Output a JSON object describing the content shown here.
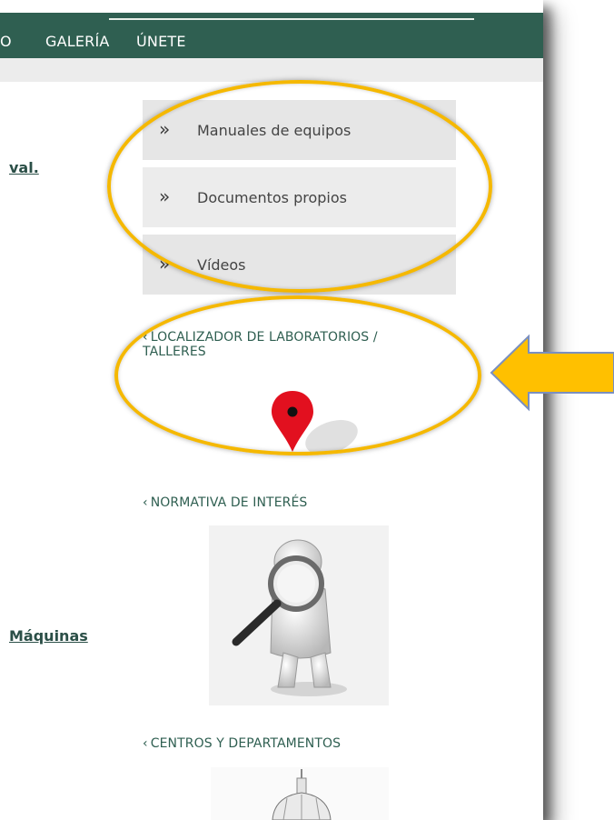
{
  "nav": {
    "items": [
      "O",
      "GALERÍA",
      "ÚNETE"
    ]
  },
  "left_links": {
    "link1": "val.",
    "link2": "Máquinas"
  },
  "sidebar_menu": [
    {
      "label": "Manuales de equipos",
      "icon": "double-chevron-right-icon"
    },
    {
      "label": "Documentos propios",
      "icon": "double-chevron-right-icon"
    },
    {
      "label": "Vídeos",
      "icon": "double-chevron-right-icon"
    }
  ],
  "sections": {
    "localizador": {
      "line1": "LOCALIZADOR DE LABORATORIOS /",
      "line2": "TALLERES",
      "icon": "map-pin-icon"
    },
    "normativa": {
      "title": "NORMATIVA DE INTERÉS",
      "image": "magnifying-glass-figure-image"
    },
    "centros": {
      "title": "CENTROS Y DEPARTAMENTOS",
      "image": "dome-building-image"
    }
  },
  "glyphs": {
    "chevron": "»",
    "back": "‹"
  },
  "colors": {
    "nav_bg": "#2f5f51",
    "highlight": "#f5b800",
    "arrow": "#ffc000",
    "arrow_border": "#7a8fc0",
    "pin": "#e2101f"
  }
}
